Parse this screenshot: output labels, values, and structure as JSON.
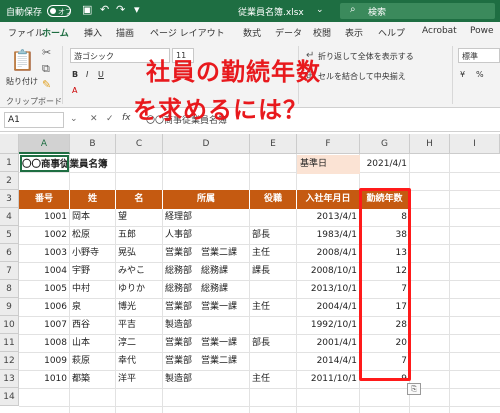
{
  "title_bar": {
    "autosave_label": "自動保存",
    "toggle_state": "オフ",
    "filename": "従業員名簿.xlsx",
    "search_placeholder": "検索"
  },
  "tabs": [
    "ファイル",
    "ホーム",
    "挿入",
    "描画",
    "ページ レイアウト",
    "数式",
    "データ",
    "校閲",
    "表示",
    "ヘルプ",
    "Acrobat",
    "Powe"
  ],
  "active_tab": "ホーム",
  "ribbon": {
    "paste_label": "貼り付け",
    "clipboard_group": "クリップボード",
    "font_name": "游ゴシック",
    "font_size": "11",
    "wrap_text": "折り返して全体を表示する",
    "merge_center": "セルを結合して中央揃え",
    "number_format": "標準"
  },
  "formula_bar": {
    "name_box": "A1",
    "fx": "fx",
    "content": "〇〇商事従業員名簿"
  },
  "column_headers": [
    "A",
    "B",
    "C",
    "D",
    "E",
    "F",
    "G",
    "H",
    "I"
  ],
  "row_headers": [
    "1",
    "2",
    "3",
    "4",
    "5",
    "6",
    "7",
    "8",
    "9",
    "10",
    "11",
    "12",
    "13",
    "14"
  ],
  "sheet": {
    "title": "〇〇商事従業員名簿",
    "kijunbi_label": "基準日",
    "kijunbi_value": "2021/4/1",
    "headers": [
      "番号",
      "姓",
      "名",
      "所属",
      "役職",
      "入社年月日",
      "勤続年数"
    ],
    "rows": [
      {
        "no": "1001",
        "sei": "岡本",
        "mei": "望",
        "dept": "経理部",
        "title": "",
        "date": "2013/4/1",
        "years": "8"
      },
      {
        "no": "1002",
        "sei": "松原",
        "mei": "五郎",
        "dept": "人事部",
        "title": "部長",
        "date": "1983/4/1",
        "years": "38"
      },
      {
        "no": "1003",
        "sei": "小野寺",
        "mei": "晃弘",
        "dept": "営業部　営業二課",
        "title": "主任",
        "date": "2008/4/1",
        "years": "13"
      },
      {
        "no": "1004",
        "sei": "宇野",
        "mei": "みやこ",
        "dept": "総務部　総務課",
        "title": "課長",
        "date": "2008/10/1",
        "years": "12"
      },
      {
        "no": "1005",
        "sei": "中村",
        "mei": "ゆりか",
        "dept": "総務部　総務課",
        "title": "",
        "date": "2013/10/1",
        "years": "7"
      },
      {
        "no": "1006",
        "sei": "泉",
        "mei": "博光",
        "dept": "営業部　営業一課",
        "title": "主任",
        "date": "2004/4/1",
        "years": "17"
      },
      {
        "no": "1007",
        "sei": "西谷",
        "mei": "平吉",
        "dept": "製造部",
        "title": "",
        "date": "1992/10/1",
        "years": "28"
      },
      {
        "no": "1008",
        "sei": "山本",
        "mei": "淳二",
        "dept": "営業部　営業一課",
        "title": "部長",
        "date": "2001/4/1",
        "years": "20"
      },
      {
        "no": "1009",
        "sei": "萩原",
        "mei": "幸代",
        "dept": "営業部　営業二課",
        "title": "",
        "date": "2014/4/1",
        "years": "7"
      },
      {
        "no": "1010",
        "sei": "都築",
        "mei": "洋平",
        "dept": "製造部",
        "title": "主任",
        "date": "2011/10/1",
        "years": "9"
      }
    ]
  },
  "overlay": {
    "line1": "社員の勤続年数",
    "line2": "を求めるには？"
  },
  "colors": {
    "excel_green": "#1e6e42",
    "header_orange": "#c55a11",
    "kijun_fill": "#fbe3d4",
    "highlight_red": "#ff1a1a"
  }
}
